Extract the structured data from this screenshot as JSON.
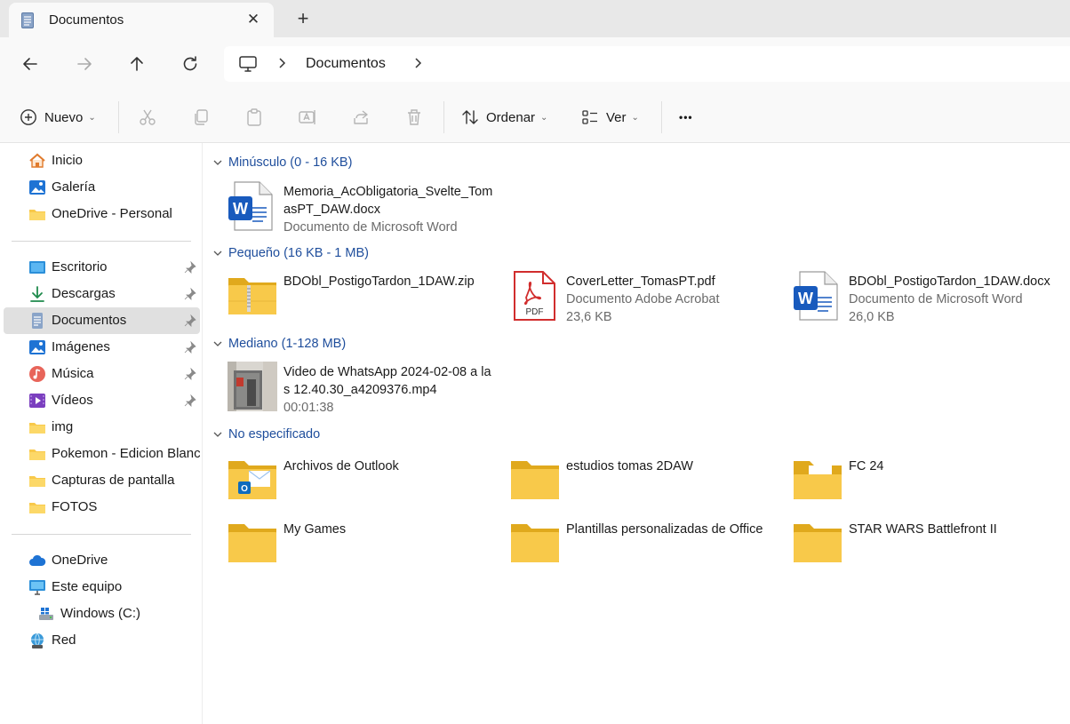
{
  "window": {
    "tab_title": "Documentos",
    "close_glyph": "✕",
    "new_tab_glyph": "+"
  },
  "address": {
    "current": "Documentos"
  },
  "commands": {
    "new_label": "Nuevo",
    "sort_label": "Ordenar",
    "view_label": "Ver",
    "more_glyph": "•••"
  },
  "sidebar": {
    "home": "Inicio",
    "gallery": "Galería",
    "onedrive_personal": "OneDrive - Personal",
    "desktop": "Escritorio",
    "downloads": "Descargas",
    "documents": "Documentos",
    "pictures": "Imágenes",
    "music": "Música",
    "videos": "Vídeos",
    "img": "img",
    "pokemon": "Pokemon - Edicion Blanca",
    "screenshots": "Capturas de pantalla",
    "fotos": "FOTOS",
    "onedrive": "OneDrive",
    "this_pc": "Este equipo",
    "windows_c": "Windows (C:)",
    "network": "Red"
  },
  "groups": {
    "tiny": "Minúsculo (0 - 16 KB)",
    "small": "Pequeño (16 KB - 1 MB)",
    "medium": "Mediano (1-128 MB)",
    "unspecified": "No especificado"
  },
  "files": {
    "memoria": {
      "name": "Memoria_AcObligatoria_Svelte_TomasPT_DAW.docx",
      "type": "Documento de Microsoft Word"
    },
    "zip": {
      "name": "BDObl_PostigoTardon_1DAW.zip"
    },
    "pdf": {
      "name": "CoverLetter_TomasPT.pdf",
      "type": "Documento Adobe Acrobat",
      "size": "23,6 KB",
      "badge": "PDF"
    },
    "docx": {
      "name": "BDObl_PostigoTardon_1DAW.docx",
      "type": "Documento de Microsoft Word",
      "size": "26,0 KB"
    },
    "video": {
      "name": "Video de WhatsApp 2024-02-08 a las 12.40.30_a4209376.mp4",
      "duration": "00:01:38"
    }
  },
  "folders": {
    "outlook": "Archivos de Outlook",
    "estudios": "estudios tomas 2DAW",
    "fc24": "FC 24",
    "mygames": "My Games",
    "plantillas": "Plantillas personalizadas de Office",
    "starwars": "STAR WARS Battlefront II"
  },
  "colors": {
    "accent": "#1f4e9c",
    "folder": "#f8c94a",
    "word_blue": "#185abd",
    "pdf_red": "#d12d2d",
    "selected_bg": "#e0e0e0"
  }
}
